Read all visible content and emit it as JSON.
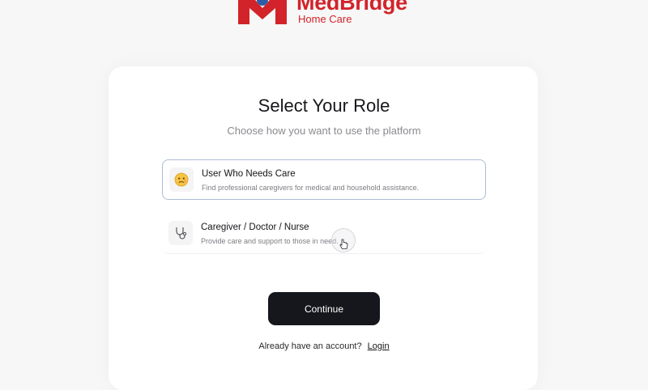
{
  "brand": {
    "name": "MedBridge",
    "tagline": "Home Care",
    "accent_color": "#d2232a"
  },
  "heading": {
    "title": "Select Your Role",
    "subtitle": "Choose how you want to use the platform"
  },
  "roles": [
    {
      "title": "User Who Needs Care",
      "description": "Find professional caregivers for medical and household assistance.",
      "icon": "worried-face-icon",
      "selected": true
    },
    {
      "title": "Caregiver / Doctor / Nurse",
      "description": "Provide care and support to those in need.",
      "icon": "stethoscope-icon",
      "selected": false
    }
  ],
  "actions": {
    "continue_label": "Continue",
    "button_color": "#16171c"
  },
  "footer": {
    "prompt": "Already have an account?",
    "login_label": "Login"
  }
}
